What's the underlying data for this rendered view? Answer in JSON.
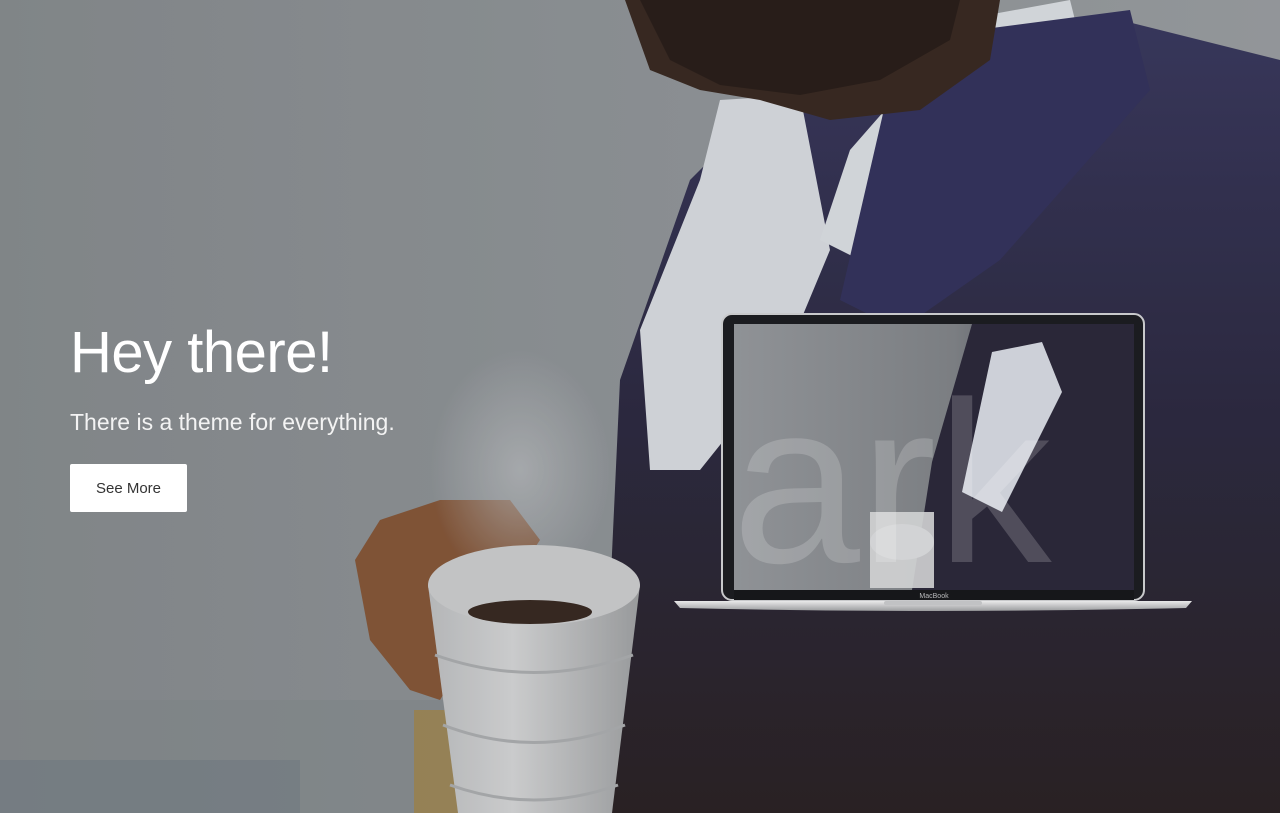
{
  "hero": {
    "title": "Hey there!",
    "subtitle": "There is a theme for everything.",
    "cta_label": "See More"
  },
  "laptop": {
    "screen_watermark": "ark",
    "brand": "MacBook"
  },
  "colors": {
    "jacket": "#2a2a4a",
    "shirt": "#e8ecf2",
    "overlay": "#8f9498",
    "button_bg": "#ffffff",
    "button_text": "#333333"
  }
}
